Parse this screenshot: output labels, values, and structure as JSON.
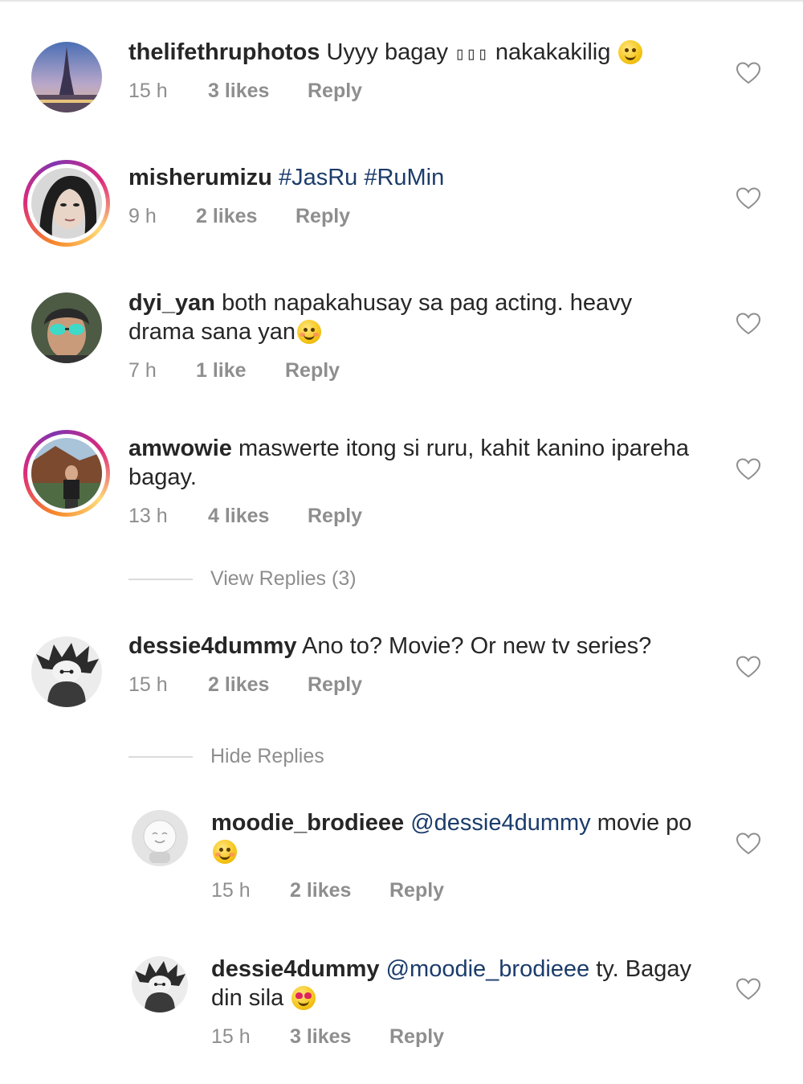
{
  "comments": [
    {
      "username": "thelifethruphotos",
      "text_before": "Uyyy bagay",
      "glyphs": "▯▯▯",
      "text_after": "nakakakilig",
      "time": "15 h",
      "likes": "3 likes",
      "reply": "Reply"
    },
    {
      "username": "misherumizu",
      "hashtags": "#JasRu #RuMin",
      "time": "9 h",
      "likes": "2 likes",
      "reply": "Reply"
    },
    {
      "username": "dyi_yan",
      "text": "both napakahusay sa pag acting. heavy drama sana yan",
      "time": "7 h",
      "likes": "1 like",
      "reply": "Reply"
    },
    {
      "username": "amwowie",
      "text": "maswerte itong si ruru, kahit kanino ipareha bagay.",
      "time": "13 h",
      "likes": "4 likes",
      "reply": "Reply",
      "view_replies": "View Replies (3)"
    },
    {
      "username": "dessie4dummy",
      "text": "Ano to? Movie? Or new tv series?",
      "time": "15 h",
      "likes": "2 likes",
      "reply": "Reply",
      "hide_replies": "Hide Replies"
    }
  ],
  "replies": [
    {
      "username": "moodie_brodieee",
      "mention": "@dessie4dummy",
      "text": "movie po",
      "time": "15 h",
      "likes": "2 likes",
      "reply": "Reply"
    },
    {
      "username": "dessie4dummy",
      "mention": "@moodie_brodieee",
      "text": "ty. Bagay din sila",
      "time": "15 h",
      "likes": "3 likes",
      "reply": "Reply"
    }
  ],
  "colors": {
    "text": "#262626",
    "meta": "#8e8e8e",
    "link": "#1b3c6b",
    "story_ring": "#dd2a7b"
  },
  "icons": {
    "like": "heart-outline-icon",
    "emoji_smile": "slightly-smiling-face-emoji",
    "emoji_blush": "smiling-face-with-smiling-eyes-emoji",
    "emoji_love": "heart-eyes-emoji"
  }
}
